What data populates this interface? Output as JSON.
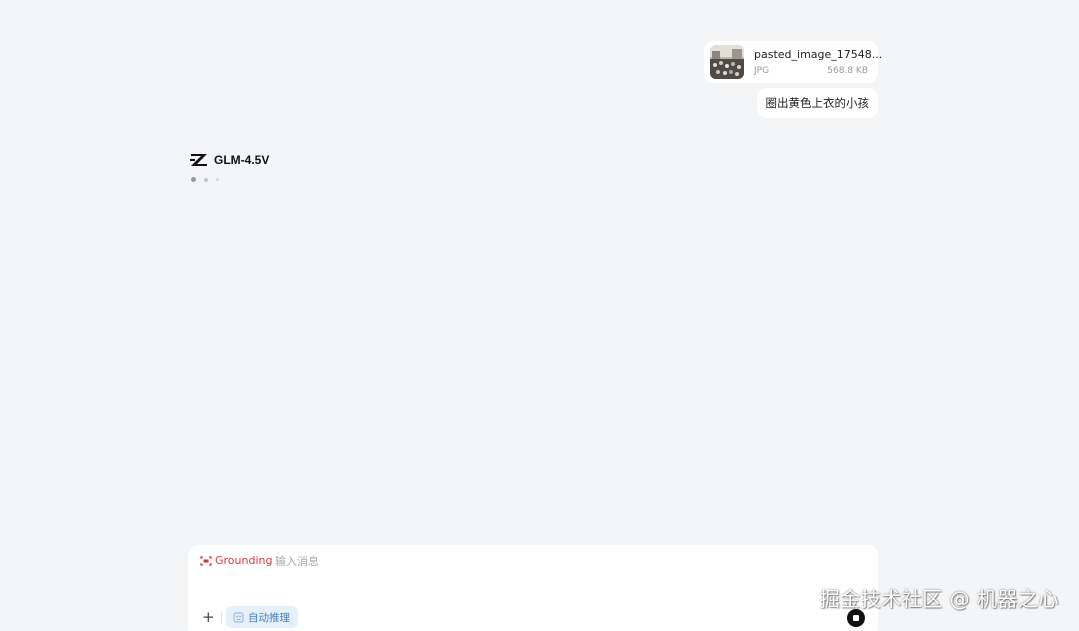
{
  "colors": {
    "page_background": "#f4f5f7",
    "card_background": "#ffffff",
    "grounding_red": "#d03a3a",
    "auto_reason_bg": "#e6f0fb",
    "auto_reason_text": "#4d7fbf"
  },
  "attachment": {
    "name": "pasted_image_17548...",
    "type": "JPG",
    "size": "568.8 KB",
    "thumbnail_icon": "crowd-photo-thumbnail"
  },
  "user_message": {
    "text": "圈出黄色上衣的小孩"
  },
  "assistant": {
    "model_name": "GLM-4.5V",
    "logo_icon": "zhipu-z-logo-icon",
    "status": "typing-indicator"
  },
  "composer": {
    "grounding_label": "Grounding",
    "grounding_icon": "grounding-frame-icon",
    "placeholder": "输入消息",
    "value": "",
    "plus_icon": "plus-icon",
    "auto_reason_label": "自动推理",
    "auto_reason_icon": "brain-icon",
    "stop_icon": "stop-icon"
  },
  "watermark": {
    "text": "掘金技术社区 @ 机器之心"
  }
}
